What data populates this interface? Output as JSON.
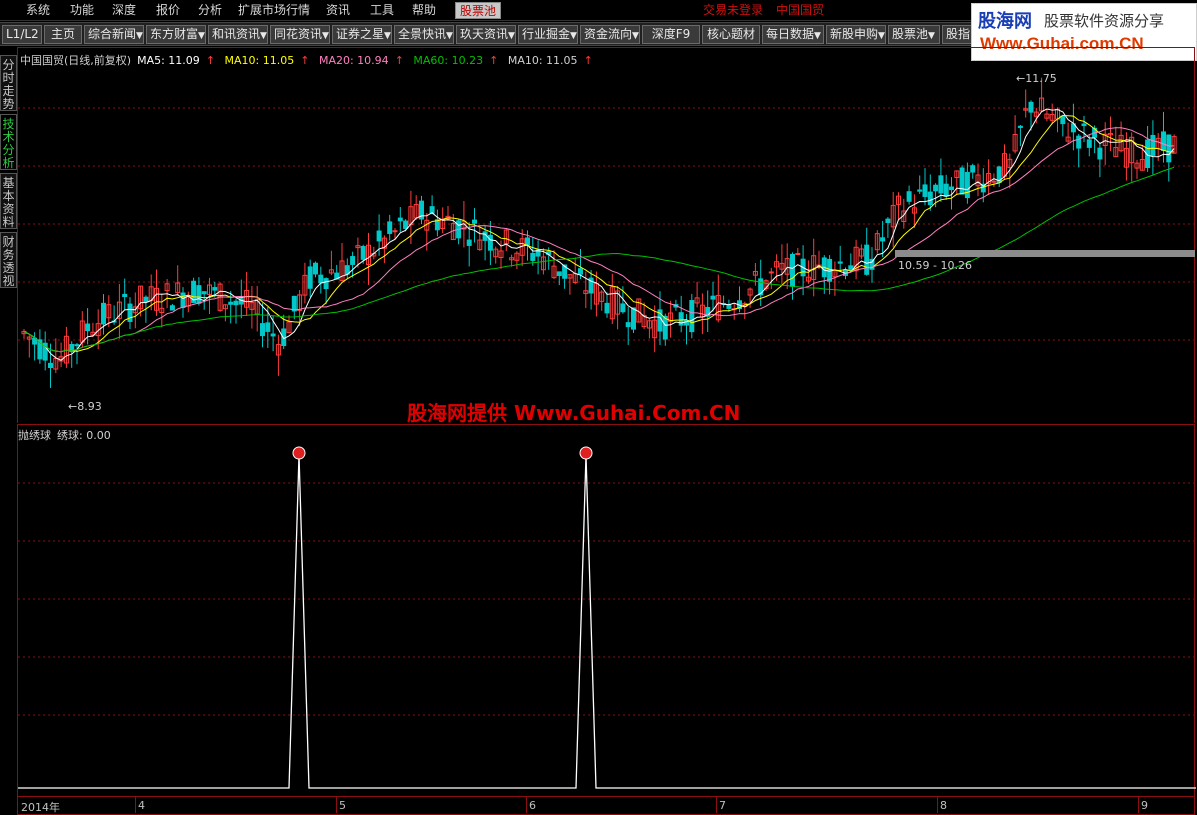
{
  "menu": {
    "items": [
      "系统",
      "功能",
      "深度",
      "报价",
      "分析",
      "扩展市场行情",
      "资讯",
      "工具",
      "帮助",
      "股票池"
    ],
    "status_login": "交易未登录",
    "status_stock": "中国国贸"
  },
  "toolbar": {
    "level": "L1/L2",
    "buttons": [
      "主页",
      "综合新闻",
      "东方财富",
      "和讯资讯",
      "同花资讯",
      "证券之星",
      "全景快讯",
      "玖天资讯",
      "行业掘金",
      "资金流向",
      "深度F9",
      "核心题材",
      "每日数据",
      "新股申购",
      "股票池",
      "股指"
    ]
  },
  "logo": {
    "brand": "股海网",
    "slogan": "股票软件资源分享",
    "url": "Www.Guhai.com.CN"
  },
  "side_tabs": [
    "分时走势",
    "技术分析",
    "基本资料",
    "财务透视"
  ],
  "main_legend": {
    "title": "中国国贸(日线,前复权)",
    "ma5": "MA5: 11.09",
    "ma10": "MA10: 11.05",
    "ma20": "MA20: 10.94",
    "ma60": "MA60: 10.23",
    "ma10b": "MA10: 11.05",
    "arrow": "↑"
  },
  "annotations": {
    "low": "8.93",
    "high": "11.75",
    "range": "10.59 - 10.26",
    "low_arrow": "←",
    "high_arrow": "←"
  },
  "promo_text": "股海网提供 Www.Guhai.Com.CN",
  "sub_legend": {
    "name": "抛绣球",
    "value": "绣球: 0.00"
  },
  "x_axis": {
    "labels": [
      "2014年",
      "4",
      "5",
      "6",
      "7",
      "8",
      "9"
    ]
  },
  "colors": {
    "up": "#ff3c3c",
    "down": "#00c8c8",
    "ma5": "#ffffff",
    "ma10": "#ffff00",
    "ma20": "#ff80c0",
    "ma60": "#00c000",
    "grid": "#8a1010"
  },
  "chart_data": {
    "type": "candlestick",
    "title": "中国国贸(日线,前复权)",
    "period": "2014年 3月 - 9月",
    "price_low": 8.93,
    "price_high": 11.75,
    "indicator": {
      "name": "抛绣球",
      "series_name": "绣球",
      "current_value": 0.0,
      "signal_months": [
        "5",
        "6"
      ],
      "signal_count": 2
    },
    "moving_averages": {
      "MA5": 11.09,
      "MA10": 11.05,
      "MA20": 10.94,
      "MA60": 10.23
    }
  }
}
